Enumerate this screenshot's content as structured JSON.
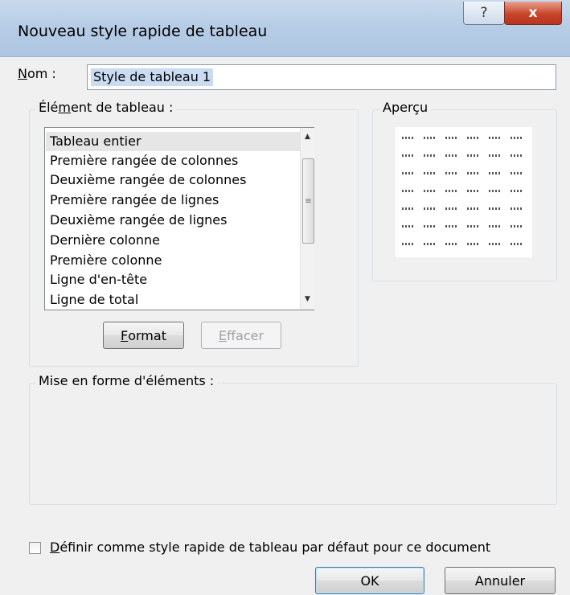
{
  "window": {
    "title": "Nouveau style rapide de tableau",
    "help_glyph": "?",
    "close_glyph": "x"
  },
  "name_field": {
    "label_accel": "N",
    "label_rest": "om :",
    "value": "Style de tableau 1"
  },
  "element_group": {
    "title_pre": "Élé",
    "title_accel": "m",
    "title_post": "ent de tableau :",
    "items": [
      "Tableau entier",
      "Première rangée de colonnes",
      "Deuxième rangée de colonnes",
      "Première rangée de lignes",
      "Deuxième rangée de lignes",
      "Dernière colonne",
      "Première colonne",
      "Ligne d'en-tête",
      "Ligne de total"
    ],
    "selected_index": 0,
    "format_accel": "F",
    "format_rest": "ormat",
    "clear_accel": "E",
    "clear_rest": "ffacer"
  },
  "preview_group": {
    "title": "Aperçu",
    "rows": 7,
    "cols": 6,
    "cell_text": "ooo"
  },
  "formatting_group": {
    "title": "Mise en forme d'éléments :"
  },
  "default_checkbox": {
    "accel": "D",
    "rest": "éfinir comme style rapide de tableau par défaut pour ce document",
    "checked": false
  },
  "buttons": {
    "ok": "OK",
    "cancel": "Annuler"
  }
}
